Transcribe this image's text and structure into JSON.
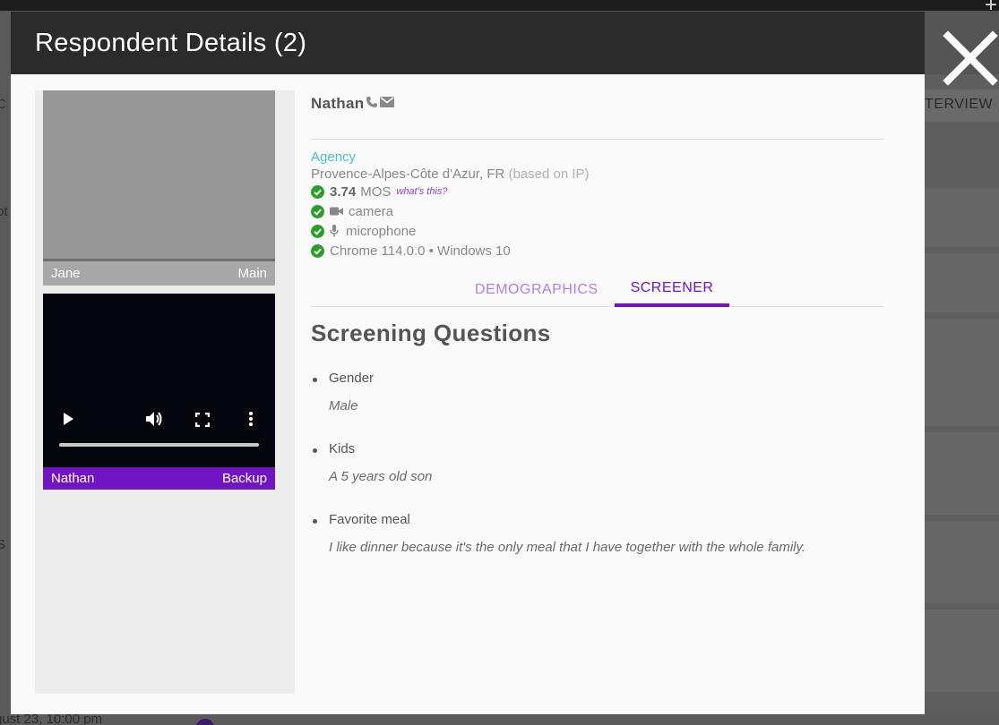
{
  "background": {
    "interview_header": "TERVIEW",
    "bottom_text": "gust 23, 10:00 pm",
    "left_fragments": [
      "C",
      "ot",
      "ot",
      "ot",
      "ot",
      "S",
      "S"
    ]
  },
  "modal": {
    "title": "Respondent Details (2)"
  },
  "videos": {
    "main": {
      "name": "Jane",
      "role": "Main"
    },
    "backup": {
      "name": "Nathan",
      "role": "Backup",
      "progress": 0
    }
  },
  "respondent": {
    "name": "Nathan",
    "agency": "Agency",
    "location": "Provence-Alpes-Côte d'Azur, FR",
    "location_note": "(based on IP)",
    "mos_value": "3.74",
    "mos_label": "MOS",
    "mos_help": "what's this?",
    "camera": "camera",
    "microphone": "microphone",
    "browser": "Chrome 114.0.0 • Windows 10"
  },
  "tabs": [
    {
      "label": "DEMOGRAPHICS",
      "active": false
    },
    {
      "label": "SCREENER",
      "active": true
    }
  ],
  "screener": {
    "title": "Screening Questions",
    "questions": [
      {
        "label": "Gender",
        "answer": "Male"
      },
      {
        "label": "Kids",
        "answer": "A 5 years old son"
      },
      {
        "label": "Favorite meal",
        "answer": "I like dinner because it's the only meal that I have together with the whole family."
      }
    ]
  },
  "colors": {
    "accent": "#7114c4",
    "agency": "#4bbfc3",
    "check": "#2e9d2e",
    "header": "#2b2b2b"
  },
  "icons": [
    "phone-icon",
    "email-icon",
    "check-icon",
    "camera-icon",
    "microphone-icon",
    "play-icon",
    "volume-icon",
    "fullscreen-icon",
    "more-vert-icon",
    "close-icon"
  ]
}
